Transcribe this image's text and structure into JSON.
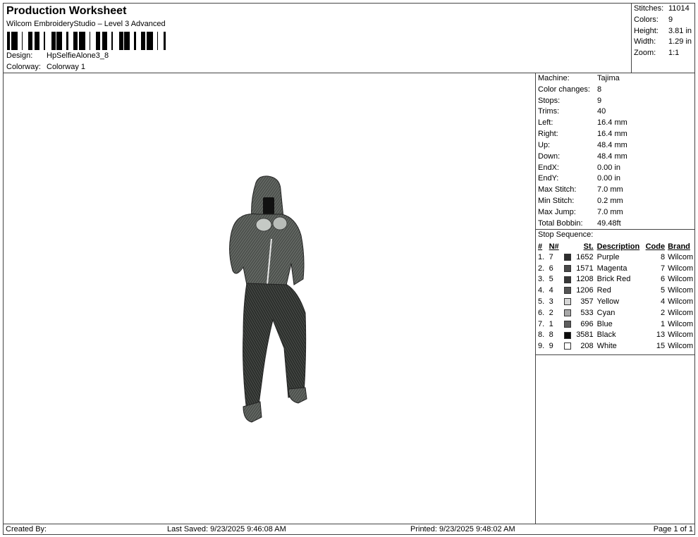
{
  "header": {
    "title": "Production Worksheet",
    "software": "Wilcom EmbroideryStudio – Level 3 Advanced",
    "design_label": "Design:",
    "design_value": "HpSelfieAlone3_8",
    "colorway_label": "Colorway:",
    "colorway_value": "Colorway 1"
  },
  "summary": [
    {
      "label": "Stitches:",
      "value": "11014"
    },
    {
      "label": "Colors:",
      "value": "9"
    },
    {
      "label": "Height:",
      "value": "3.81 in"
    },
    {
      "label": "Width:",
      "value": "1.29 in"
    },
    {
      "label": "Zoom:",
      "value": "1:1"
    }
  ],
  "details": [
    {
      "label": "Machine:",
      "value": "Tajima"
    },
    {
      "label": "Color changes:",
      "value": "8"
    },
    {
      "label": "Stops:",
      "value": "9"
    },
    {
      "label": "Trims:",
      "value": "40"
    },
    {
      "label": "Left:",
      "value": "16.4 mm"
    },
    {
      "label": "Right:",
      "value": "16.4 mm"
    },
    {
      "label": "Up:",
      "value": "48.4 mm"
    },
    {
      "label": "Down:",
      "value": "48.4 mm"
    },
    {
      "label": "EndX:",
      "value": "0.00 in"
    },
    {
      "label": "EndY:",
      "value": "0.00 in"
    },
    {
      "label": "Max Stitch:",
      "value": "7.0 mm"
    },
    {
      "label": "Min Stitch:",
      "value": "0.2 mm"
    },
    {
      "label": "Max Jump:",
      "value": "7.0 mm"
    },
    {
      "label": "Total Bobbin:",
      "value": "49.48ft"
    }
  ],
  "stop_sequence": {
    "title": "Stop Sequence:",
    "headers": {
      "num": "#",
      "n": "N#",
      "st": "St.",
      "desc": "Description",
      "code": "Code",
      "brand": "Brand"
    },
    "rows": [
      {
        "num": "1.",
        "n": "7",
        "color": "#2e2e2e",
        "st": "1652",
        "desc": "Purple",
        "code": "8",
        "brand": "Wilcom"
      },
      {
        "num": "2.",
        "n": "6",
        "color": "#4a4a4a",
        "st": "1571",
        "desc": "Magenta",
        "code": "7",
        "brand": "Wilcom"
      },
      {
        "num": "3.",
        "n": "5",
        "color": "#383838",
        "st": "1208",
        "desc": "Brick Red",
        "code": "6",
        "brand": "Wilcom"
      },
      {
        "num": "4.",
        "n": "4",
        "color": "#555555",
        "st": "1206",
        "desc": "Red",
        "code": "5",
        "brand": "Wilcom"
      },
      {
        "num": "5.",
        "n": "3",
        "color": "#d6d6d6",
        "st": "357",
        "desc": "Yellow",
        "code": "4",
        "brand": "Wilcom"
      },
      {
        "num": "6.",
        "n": "2",
        "color": "#a8a8a8",
        "st": "533",
        "desc": "Cyan",
        "code": "2",
        "brand": "Wilcom"
      },
      {
        "num": "7.",
        "n": "1",
        "color": "#5e5e5e",
        "st": "696",
        "desc": "Blue",
        "code": "1",
        "brand": "Wilcom"
      },
      {
        "num": "8.",
        "n": "8",
        "color": "#0a0a0a",
        "st": "3581",
        "desc": "Black",
        "code": "13",
        "brand": "Wilcom"
      },
      {
        "num": "9.",
        "n": "9",
        "color": "#ffffff",
        "st": "208",
        "desc": "White",
        "code": "15",
        "brand": "Wilcom"
      }
    ]
  },
  "footer": {
    "created_by": "Created By:",
    "last_saved": "Last Saved: 9/23/2025 9:46:08 AM",
    "printed": "Printed: 9/23/2025 9:48:02 AM",
    "page": "Page 1 of 1"
  }
}
